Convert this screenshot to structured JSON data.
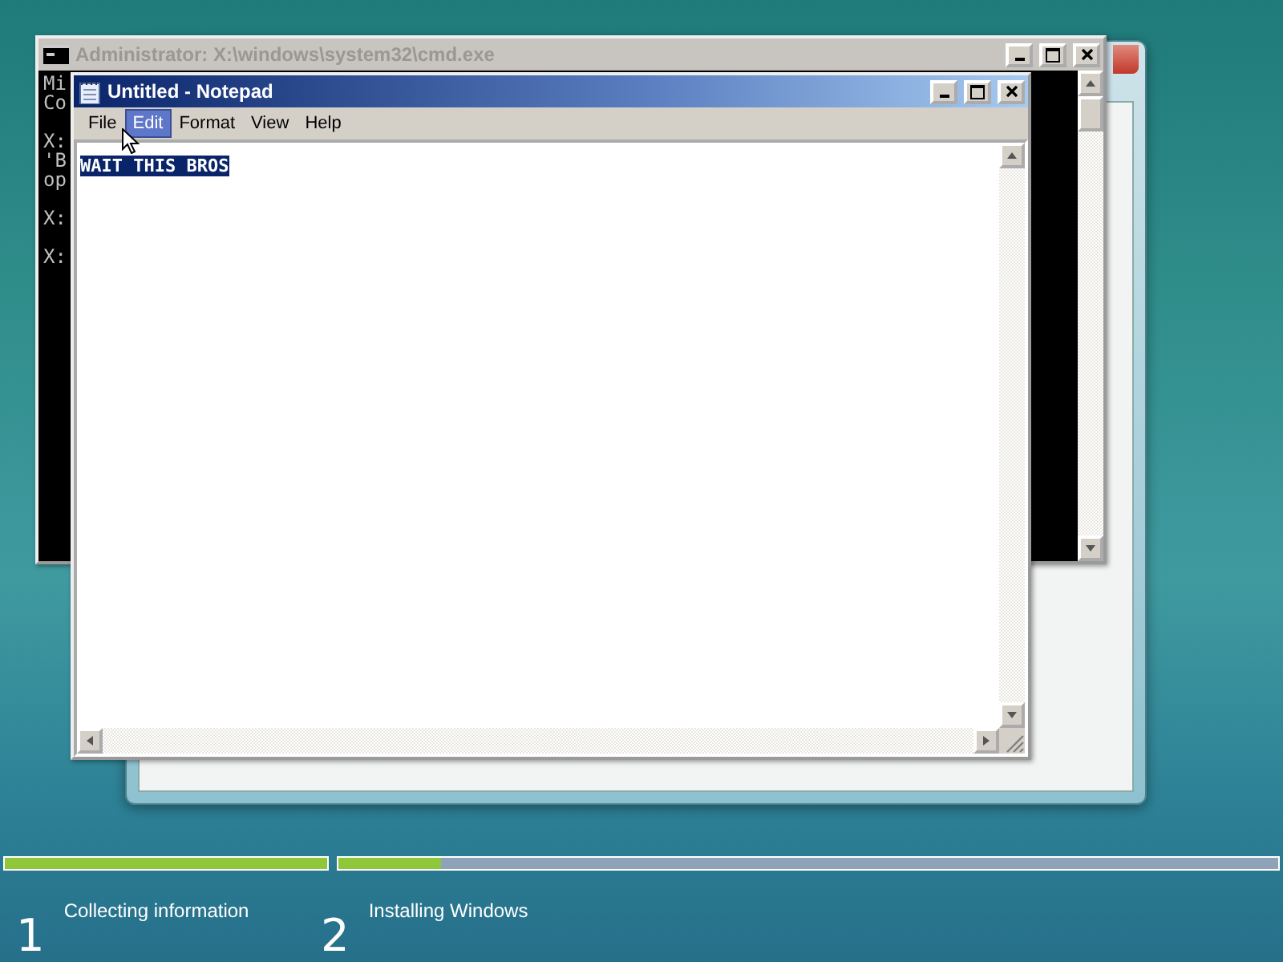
{
  "cmd_window": {
    "title": "Administrator: X:\\windows\\system32\\cmd.exe",
    "line_groups": [
      [
        "Mi",
        "Co"
      ],
      [
        "X:",
        "'B",
        "op"
      ],
      [
        "X:"
      ],
      [
        "X:"
      ]
    ]
  },
  "notepad": {
    "title": "Untitled - Notepad",
    "menu": [
      {
        "label": "File",
        "selected": false
      },
      {
        "label": "Edit",
        "selected": true
      },
      {
        "label": "Format",
        "selected": false
      },
      {
        "label": "View",
        "selected": false
      },
      {
        "label": "Help",
        "selected": false
      }
    ],
    "text": "WAIT THIS BROS",
    "text_selected": true
  },
  "setup_progress": [
    {
      "number": "1",
      "label": "Collecting information",
      "level": 1
    },
    {
      "number": "2",
      "label": "Installing Windows",
      "level": 0.11
    }
  ]
}
